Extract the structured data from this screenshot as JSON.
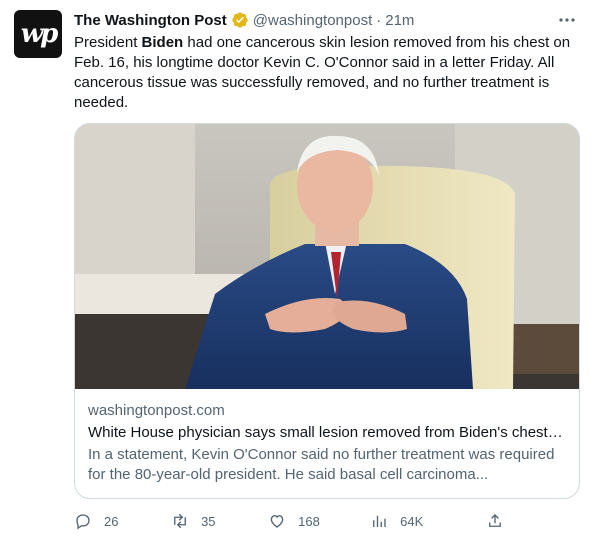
{
  "tweet": {
    "avatar_text": "wp",
    "author": "The Washington Post",
    "handle": "@washingtonpost",
    "separator": "·",
    "time": "21m",
    "text_before": "President ",
    "text_bold": "Biden",
    "text_after": " had one cancerous skin lesion removed from his chest on Feb. 16, his longtime doctor Kevin C. O'Connor said in a letter Friday. All cancerous tissue was successfully removed, and no further treatment is needed."
  },
  "card": {
    "domain": "washingtonpost.com",
    "title": "White House physician says small lesion removed from Biden's chest is basal cell carcinoma",
    "description": "In a statement, Kevin O'Connor said no further treatment was required for the 80-year-old president. He said basal cell carcinoma..."
  },
  "actions": {
    "replies": "26",
    "retweets": "35",
    "likes": "168",
    "views": "64K"
  },
  "colors": {
    "text": "#0f1419",
    "secondary": "#536471",
    "border": "#cfd9de",
    "verified_gold": "#e2b719"
  },
  "icons": [
    "verified-badge-icon",
    "more-icon",
    "reply-icon",
    "retweet-icon",
    "like-icon",
    "views-icon",
    "share-icon"
  ]
}
